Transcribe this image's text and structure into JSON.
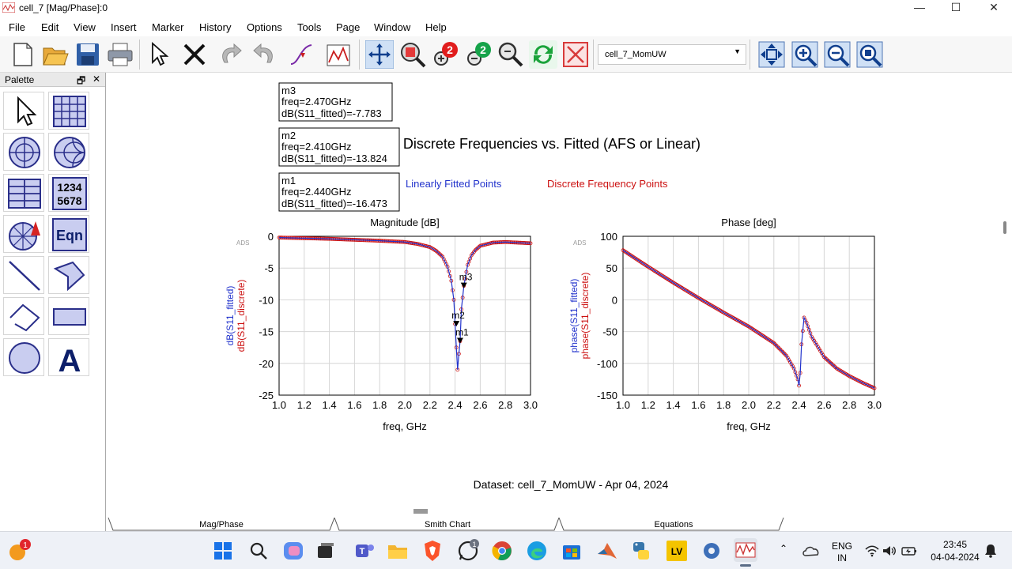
{
  "window": {
    "title": "cell_7 [Mag/Phase]:0",
    "minimize": "—",
    "maximize": "☐",
    "close": "✕"
  },
  "menu": [
    "File",
    "Edit",
    "View",
    "Insert",
    "Marker",
    "History",
    "Options",
    "Tools",
    "Page",
    "Window",
    "Help"
  ],
  "toolbar": {
    "dataset": "cell_7_MomUW",
    "icons": [
      "new-page-icon",
      "open-folder-icon",
      "save-icon",
      "print-icon",
      "select-arrow-icon",
      "delete-icon",
      "undo-icon",
      "redo-icon",
      "insert-marker-icon",
      "insert-plot-icon",
      "pan-icon",
      "zoom-region-icon",
      "zoom-in-2x-icon",
      "zoom-out-2x-icon",
      "zoom-view-icon",
      "refresh-icon",
      "stop-icon"
    ],
    "view_icons": [
      "view-all-icon",
      "view-zoom-in-icon",
      "view-zoom-out-icon",
      "view-zoom-area-icon"
    ],
    "refresh_color": "#1aa33a",
    "stop_color": "#d83a3a"
  },
  "palette": {
    "title": "Palette",
    "restore": "🗗",
    "close": "✕",
    "items": [
      {
        "name": "select-pointer-icon",
        "label": ""
      },
      {
        "name": "rectangular-plot-icon",
        "label": ""
      },
      {
        "name": "polar-plot-icon",
        "label": ""
      },
      {
        "name": "smith-chart-icon",
        "label": ""
      },
      {
        "name": "list-table-icon",
        "label": ""
      },
      {
        "name": "stacked-data-icon",
        "label": "1234\n5678"
      },
      {
        "name": "antenna-plot-icon",
        "label": ""
      },
      {
        "name": "equation-icon",
        "label": "Eqn"
      },
      {
        "name": "line-icon",
        "label": ""
      },
      {
        "name": "polygon-icon",
        "label": ""
      },
      {
        "name": "polyline-icon",
        "label": ""
      },
      {
        "name": "rectangle-icon",
        "label": ""
      },
      {
        "name": "circle-icon",
        "label": ""
      },
      {
        "name": "text-icon",
        "label": "A"
      }
    ]
  },
  "page": {
    "title": "Discrete Frequencies vs. Fitted (AFS or Linear)",
    "legend_fitted": "Linearly Fitted Points",
    "legend_discrete": "Discrete Frequency Points",
    "fitted_color": "#2233cc",
    "discrete_color": "#cc1111",
    "dataset_caption": "Dataset: cell_7_MomUW - Apr 04, 2024",
    "ads_logo": "ADS",
    "markers": [
      {
        "id": "m3",
        "line1": "m3",
        "line2": "freq=2.470GHz",
        "line3": "dB(S11_fitted)=-7.783"
      },
      {
        "id": "m2",
        "line1": "m2",
        "line2": "freq=2.410GHz",
        "line3": "dB(S11_fitted)=-13.824"
      },
      {
        "id": "m1",
        "line1": "m1",
        "line2": "freq=2.440GHz",
        "line3": "dB(S11_fitted)=-16.473"
      }
    ]
  },
  "chart_data": [
    {
      "type": "line",
      "title": "Magnitude [dB]",
      "xlabel": "freq, GHz",
      "ylabel_fitted": "dB(S11_fitted)",
      "ylabel_discrete": "dB(S11_discrete)",
      "xlim": [
        1.0,
        3.0
      ],
      "ylim": [
        -25,
        0
      ],
      "xticks": [
        "1.0",
        "1.2",
        "1.4",
        "1.6",
        "1.8",
        "2.0",
        "2.2",
        "2.4",
        "2.6",
        "2.8",
        "3.0"
      ],
      "yticks": [
        "0",
        "-5",
        "-10",
        "-15",
        "-20",
        "-25"
      ],
      "grid": true,
      "x": [
        1.0,
        1.2,
        1.4,
        1.6,
        1.8,
        2.0,
        2.1,
        2.2,
        2.25,
        2.3,
        2.34,
        2.37,
        2.39,
        2.4,
        2.41,
        2.42,
        2.43,
        2.44,
        2.45,
        2.47,
        2.5,
        2.53,
        2.56,
        2.6,
        2.7,
        2.8,
        2.9,
        3.0
      ],
      "series": [
        {
          "name": "dB(S11_fitted)",
          "values": [
            -0.2,
            -0.3,
            -0.4,
            -0.55,
            -0.7,
            -0.9,
            -1.2,
            -1.7,
            -2.3,
            -3.2,
            -4.8,
            -7.0,
            -10.0,
            -13.8,
            -17.5,
            -21.0,
            -18.5,
            -16.5,
            -11.5,
            -7.8,
            -4.5,
            -3.0,
            -2.2,
            -1.5,
            -1.0,
            -0.9,
            -1.0,
            -1.1
          ]
        },
        {
          "name": "dB(S11_discrete)",
          "values": [
            -0.2,
            -0.3,
            -0.4,
            -0.55,
            -0.7,
            -0.9,
            -1.2,
            -1.7,
            -2.3,
            -3.2,
            -4.8,
            -7.0,
            -10.0,
            -13.8,
            -17.5,
            -21.0,
            -18.5,
            -16.5,
            -11.5,
            -7.8,
            -4.5,
            -3.0,
            -2.2,
            -1.5,
            -1.0,
            -0.9,
            -1.0,
            -1.1
          ]
        }
      ],
      "markers": [
        {
          "label": "m3",
          "x": 2.47,
          "y": -7.783
        },
        {
          "label": "m2",
          "x": 2.41,
          "y": -13.824
        },
        {
          "label": "m1",
          "x": 2.44,
          "y": -16.473
        }
      ]
    },
    {
      "type": "line",
      "title": "Phase [deg]",
      "xlabel": "freq, GHz",
      "ylabel_fitted": "phase(S11_fitted)",
      "ylabel_discrete": "phase(S11_discrete)",
      "xlim": [
        1.0,
        3.0
      ],
      "ylim": [
        -150,
        100
      ],
      "xticks": [
        "1.0",
        "1.2",
        "1.4",
        "1.6",
        "1.8",
        "2.0",
        "2.2",
        "2.4",
        "2.6",
        "2.8",
        "3.0"
      ],
      "yticks": [
        "100",
        "50",
        "0",
        "-50",
        "-100",
        "-150"
      ],
      "grid": true,
      "x": [
        1.0,
        1.2,
        1.4,
        1.6,
        1.8,
        2.0,
        2.2,
        2.3,
        2.36,
        2.39,
        2.4,
        2.41,
        2.42,
        2.44,
        2.46,
        2.5,
        2.6,
        2.7,
        2.8,
        2.9,
        3.0
      ],
      "series": [
        {
          "name": "phase(S11_fitted)",
          "values": [
            78,
            52,
            27,
            3,
            -20,
            -42,
            -68,
            -88,
            -108,
            -125,
            -135,
            -115,
            -70,
            -28,
            -36,
            -58,
            -90,
            -108,
            -120,
            -130,
            -139
          ]
        },
        {
          "name": "phase(S11_discrete)",
          "values": [
            78,
            52,
            27,
            3,
            -20,
            -42,
            -68,
            -88,
            -108,
            -125,
            -135,
            -115,
            -70,
            -28,
            -36,
            -58,
            -90,
            -108,
            -120,
            -130,
            -139
          ]
        }
      ]
    }
  ],
  "tabs": [
    "Mag/Phase",
    "Smith Chart",
    "Equations"
  ],
  "taskbar": {
    "badge_weather": "1",
    "badge_whatsapp": "1",
    "lang_top": "ENG",
    "lang_bottom": "IN",
    "time": "23:45",
    "date": "04-04-2024",
    "up_arrow": "⌃"
  }
}
